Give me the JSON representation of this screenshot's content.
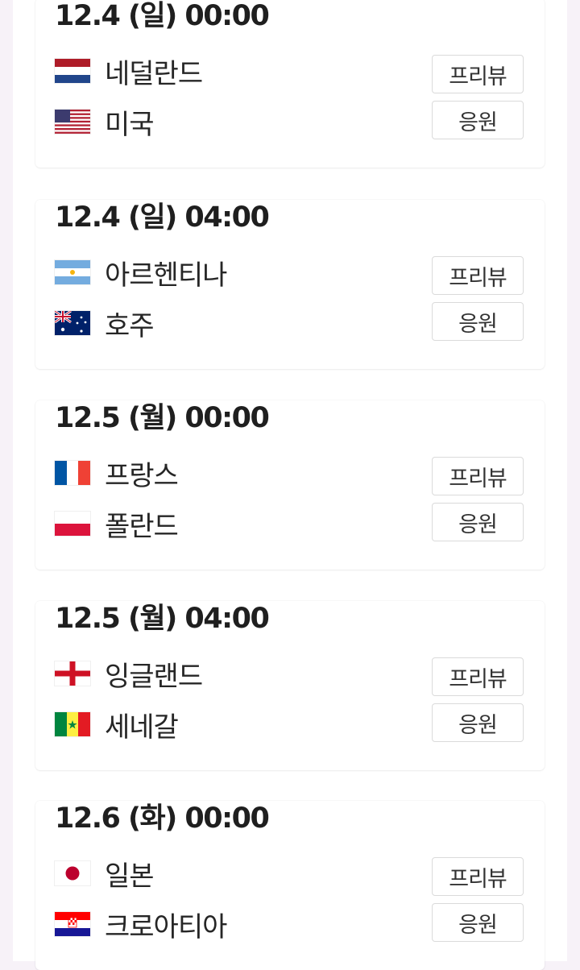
{
  "matches": [
    {
      "datetime": "12.4 (일) 00:00",
      "team_a": {
        "name": "네덜란드",
        "flag_icon": "netherlands-flag-icon"
      },
      "team_b": {
        "name": "미국",
        "flag_icon": "usa-flag-icon"
      },
      "preview_label": "프리뷰",
      "cheer_label": "응원"
    },
    {
      "datetime": "12.4 (일) 04:00",
      "team_a": {
        "name": "아르헨티나",
        "flag_icon": "argentina-flag-icon"
      },
      "team_b": {
        "name": "호주",
        "flag_icon": "australia-flag-icon"
      },
      "preview_label": "프리뷰",
      "cheer_label": "응원"
    },
    {
      "datetime": "12.5 (월) 00:00",
      "team_a": {
        "name": "프랑스",
        "flag_icon": "france-flag-icon"
      },
      "team_b": {
        "name": "폴란드",
        "flag_icon": "poland-flag-icon"
      },
      "preview_label": "프리뷰",
      "cheer_label": "응원"
    },
    {
      "datetime": "12.5 (월) 04:00",
      "team_a": {
        "name": "잉글랜드",
        "flag_icon": "england-flag-icon"
      },
      "team_b": {
        "name": "세네갈",
        "flag_icon": "senegal-flag-icon"
      },
      "preview_label": "프리뷰",
      "cheer_label": "응원"
    },
    {
      "datetime": "12.6 (화) 00:00",
      "team_a": {
        "name": "일본",
        "flag_icon": "japan-flag-icon"
      },
      "team_b": {
        "name": "크로아티아",
        "flag_icon": "croatia-flag-icon"
      },
      "preview_label": "프리뷰",
      "cheer_label": "응원"
    }
  ],
  "colors": {
    "page_background": "#f7f2f8",
    "card_background": "#ffffff",
    "button_border": "#dadada",
    "text_primary": "#1f1f1f"
  }
}
